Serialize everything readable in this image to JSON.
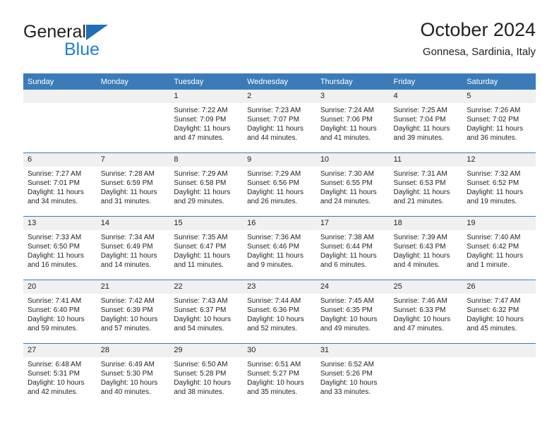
{
  "brand": {
    "name_top": "General",
    "name_bottom": "Blue",
    "triangle_color": "#1f6fb6",
    "blue_color": "#1f7fd0"
  },
  "header": {
    "title": "October 2024",
    "subtitle": "Gonnesa, Sardinia, Italy",
    "header_bg": "#3b7cb8",
    "daynum_bg": "#f0f0f0"
  },
  "weekdays": [
    "Sunday",
    "Monday",
    "Tuesday",
    "Wednesday",
    "Thursday",
    "Friday",
    "Saturday"
  ],
  "labels": {
    "sunrise": "Sunrise:",
    "sunset": "Sunset:",
    "daylight": "Daylight:"
  },
  "weeks": [
    [
      {
        "day": "",
        "blank": true
      },
      {
        "day": "",
        "blank": true
      },
      {
        "day": "1",
        "sunrise": "Sunrise: 7:22 AM",
        "sunset": "Sunset: 7:09 PM",
        "daylight": "Daylight: 11 hours and 47 minutes."
      },
      {
        "day": "2",
        "sunrise": "Sunrise: 7:23 AM",
        "sunset": "Sunset: 7:07 PM",
        "daylight": "Daylight: 11 hours and 44 minutes."
      },
      {
        "day": "3",
        "sunrise": "Sunrise: 7:24 AM",
        "sunset": "Sunset: 7:06 PM",
        "daylight": "Daylight: 11 hours and 41 minutes."
      },
      {
        "day": "4",
        "sunrise": "Sunrise: 7:25 AM",
        "sunset": "Sunset: 7:04 PM",
        "daylight": "Daylight: 11 hours and 39 minutes."
      },
      {
        "day": "5",
        "sunrise": "Sunrise: 7:26 AM",
        "sunset": "Sunset: 7:02 PM",
        "daylight": "Daylight: 11 hours and 36 minutes."
      }
    ],
    [
      {
        "day": "6",
        "sunrise": "Sunrise: 7:27 AM",
        "sunset": "Sunset: 7:01 PM",
        "daylight": "Daylight: 11 hours and 34 minutes."
      },
      {
        "day": "7",
        "sunrise": "Sunrise: 7:28 AM",
        "sunset": "Sunset: 6:59 PM",
        "daylight": "Daylight: 11 hours and 31 minutes."
      },
      {
        "day": "8",
        "sunrise": "Sunrise: 7:29 AM",
        "sunset": "Sunset: 6:58 PM",
        "daylight": "Daylight: 11 hours and 29 minutes."
      },
      {
        "day": "9",
        "sunrise": "Sunrise: 7:29 AM",
        "sunset": "Sunset: 6:56 PM",
        "daylight": "Daylight: 11 hours and 26 minutes."
      },
      {
        "day": "10",
        "sunrise": "Sunrise: 7:30 AM",
        "sunset": "Sunset: 6:55 PM",
        "daylight": "Daylight: 11 hours and 24 minutes."
      },
      {
        "day": "11",
        "sunrise": "Sunrise: 7:31 AM",
        "sunset": "Sunset: 6:53 PM",
        "daylight": "Daylight: 11 hours and 21 minutes."
      },
      {
        "day": "12",
        "sunrise": "Sunrise: 7:32 AM",
        "sunset": "Sunset: 6:52 PM",
        "daylight": "Daylight: 11 hours and 19 minutes."
      }
    ],
    [
      {
        "day": "13",
        "sunrise": "Sunrise: 7:33 AM",
        "sunset": "Sunset: 6:50 PM",
        "daylight": "Daylight: 11 hours and 16 minutes."
      },
      {
        "day": "14",
        "sunrise": "Sunrise: 7:34 AM",
        "sunset": "Sunset: 6:49 PM",
        "daylight": "Daylight: 11 hours and 14 minutes."
      },
      {
        "day": "15",
        "sunrise": "Sunrise: 7:35 AM",
        "sunset": "Sunset: 6:47 PM",
        "daylight": "Daylight: 11 hours and 11 minutes."
      },
      {
        "day": "16",
        "sunrise": "Sunrise: 7:36 AM",
        "sunset": "Sunset: 6:46 PM",
        "daylight": "Daylight: 11 hours and 9 minutes."
      },
      {
        "day": "17",
        "sunrise": "Sunrise: 7:38 AM",
        "sunset": "Sunset: 6:44 PM",
        "daylight": "Daylight: 11 hours and 6 minutes."
      },
      {
        "day": "18",
        "sunrise": "Sunrise: 7:39 AM",
        "sunset": "Sunset: 6:43 PM",
        "daylight": "Daylight: 11 hours and 4 minutes."
      },
      {
        "day": "19",
        "sunrise": "Sunrise: 7:40 AM",
        "sunset": "Sunset: 6:42 PM",
        "daylight": "Daylight: 11 hours and 1 minute."
      }
    ],
    [
      {
        "day": "20",
        "sunrise": "Sunrise: 7:41 AM",
        "sunset": "Sunset: 6:40 PM",
        "daylight": "Daylight: 10 hours and 59 minutes."
      },
      {
        "day": "21",
        "sunrise": "Sunrise: 7:42 AM",
        "sunset": "Sunset: 6:39 PM",
        "daylight": "Daylight: 10 hours and 57 minutes."
      },
      {
        "day": "22",
        "sunrise": "Sunrise: 7:43 AM",
        "sunset": "Sunset: 6:37 PM",
        "daylight": "Daylight: 10 hours and 54 minutes."
      },
      {
        "day": "23",
        "sunrise": "Sunrise: 7:44 AM",
        "sunset": "Sunset: 6:36 PM",
        "daylight": "Daylight: 10 hours and 52 minutes."
      },
      {
        "day": "24",
        "sunrise": "Sunrise: 7:45 AM",
        "sunset": "Sunset: 6:35 PM",
        "daylight": "Daylight: 10 hours and 49 minutes."
      },
      {
        "day": "25",
        "sunrise": "Sunrise: 7:46 AM",
        "sunset": "Sunset: 6:33 PM",
        "daylight": "Daylight: 10 hours and 47 minutes."
      },
      {
        "day": "26",
        "sunrise": "Sunrise: 7:47 AM",
        "sunset": "Sunset: 6:32 PM",
        "daylight": "Daylight: 10 hours and 45 minutes."
      }
    ],
    [
      {
        "day": "27",
        "sunrise": "Sunrise: 6:48 AM",
        "sunset": "Sunset: 5:31 PM",
        "daylight": "Daylight: 10 hours and 42 minutes."
      },
      {
        "day": "28",
        "sunrise": "Sunrise: 6:49 AM",
        "sunset": "Sunset: 5:30 PM",
        "daylight": "Daylight: 10 hours and 40 minutes."
      },
      {
        "day": "29",
        "sunrise": "Sunrise: 6:50 AM",
        "sunset": "Sunset: 5:28 PM",
        "daylight": "Daylight: 10 hours and 38 minutes."
      },
      {
        "day": "30",
        "sunrise": "Sunrise: 6:51 AM",
        "sunset": "Sunset: 5:27 PM",
        "daylight": "Daylight: 10 hours and 35 minutes."
      },
      {
        "day": "31",
        "sunrise": "Sunrise: 6:52 AM",
        "sunset": "Sunset: 5:26 PM",
        "daylight": "Daylight: 10 hours and 33 minutes."
      },
      {
        "day": "",
        "blank": true
      },
      {
        "day": "",
        "blank": true
      }
    ]
  ]
}
